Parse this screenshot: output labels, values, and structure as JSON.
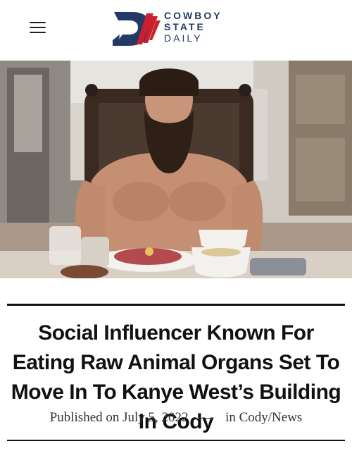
{
  "header": {
    "menu_icon": "hamburger-icon",
    "logo": {
      "line1": "COWBOY",
      "line2": "STATE",
      "line3": "DAILY",
      "primary_color": "#243a66",
      "accent_color": "#c8202e"
    }
  },
  "article": {
    "image_subject": "bearded-man-at-table-photo",
    "headline": "Social Influencer Known For Eating Raw Animal Organs Set To Move In To Kanye West’s Building In Cody",
    "published_prefix": "Published on",
    "published_date": "July 5, 2022",
    "separator": "—",
    "category_prefix": "in",
    "category": "Cody/News"
  }
}
